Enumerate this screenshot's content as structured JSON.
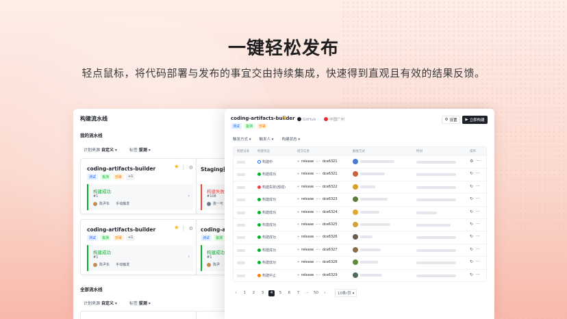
{
  "hero": {
    "title": "一键轻松发布",
    "subtitle": "轻点鼠标，将代码部署与发布的事宜交由持续集成，快速得到直观且有效的结果反馈。"
  },
  "back_panel": {
    "title": "构建流水线",
    "my_section": "我的流水线",
    "all_section": "全部流水线",
    "filters": {
      "source_label": "计划来源",
      "source_value": "自定义",
      "tag_label": "标签",
      "tag_value": "拔测"
    },
    "cards": [
      {
        "name": "coding-artifacts-builder",
        "tags": [
          "测试",
          "拔测",
          "部署",
          "+1"
        ],
        "status": "构建成功",
        "num": "#1",
        "user": "陈尹东",
        "trigger": "手动触发"
      },
      {
        "name": "Staging拔测",
        "tags": [],
        "status": "构建失败",
        "num": "#108",
        "user": "詹一可",
        "trigger": ""
      },
      {
        "name": "coding-artifacts-builder",
        "tags": [
          "测试",
          "拔测",
          "部署",
          "+1"
        ],
        "status": "构建成功",
        "num": "#1",
        "user": "陈尹东",
        "trigger": "手动触发"
      },
      {
        "name": "coding-a",
        "tags": [
          "测试",
          "拔测"
        ],
        "status": "构建成功",
        "num": "#1",
        "user": "陈尹",
        "trigger": ""
      }
    ]
  },
  "front_panel": {
    "name": "coding-artifacts-builder",
    "source": "GitHub",
    "region": "中国广州",
    "tags": [
      "测试",
      "拔测",
      "部署"
    ],
    "settings_label": "设置",
    "run_label": "立即构建",
    "filters": [
      "触发方式",
      "触发人",
      "构建状态"
    ],
    "columns": [
      "构建记录",
      "构建状态",
      "提交信息",
      "触发方式",
      "时间",
      "操作"
    ],
    "rows": [
      {
        "status": "构建中",
        "kind": "run",
        "branch": "release",
        "commit": "dce6321"
      },
      {
        "status": "构建成功",
        "kind": "ok",
        "branch": "release",
        "commit": "dce6321"
      },
      {
        "status": "构建失败(部成)",
        "kind": "fail",
        "branch": "release",
        "commit": "dce6322"
      },
      {
        "status": "构建成功",
        "kind": "ok",
        "branch": "release",
        "commit": "dce6323"
      },
      {
        "status": "构建成功",
        "kind": "ok",
        "branch": "release",
        "commit": "dce6324"
      },
      {
        "status": "构建成功",
        "kind": "ok",
        "branch": "release",
        "commit": "dce6325"
      },
      {
        "status": "构建成功",
        "kind": "ok",
        "branch": "release",
        "commit": "dce6326"
      },
      {
        "status": "构建成功",
        "kind": "ok",
        "branch": "release",
        "commit": "dce6327"
      },
      {
        "status": "构建成功",
        "kind": "ok",
        "branch": "release",
        "commit": "dce6328"
      },
      {
        "status": "构建中止",
        "kind": "stop",
        "branch": "release",
        "commit": "dce6329"
      }
    ],
    "pager": {
      "pages": [
        "1",
        "2",
        "3",
        "4",
        "5",
        "6",
        "7",
        "···",
        "50"
      ],
      "current": "4",
      "page_size": "10条/页"
    }
  }
}
